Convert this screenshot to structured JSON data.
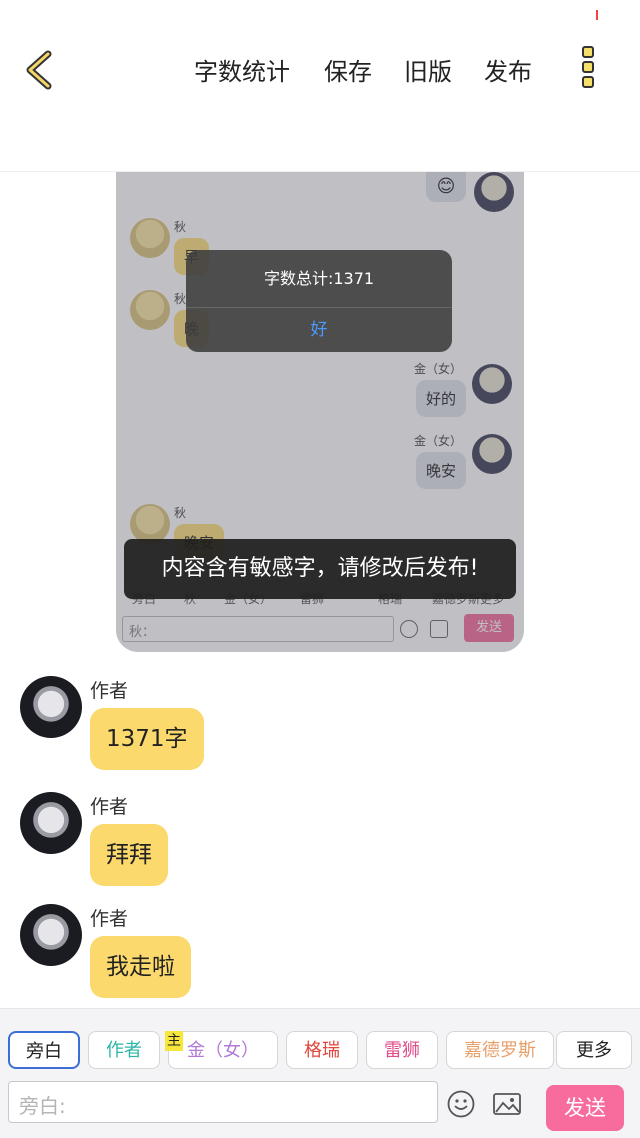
{
  "topbar": {
    "menu": [
      "字数统计",
      "保存",
      "旧版",
      "发布"
    ]
  },
  "embedded": {
    "messages": [
      {
        "name": "秋",
        "text": "早"
      },
      {
        "name": "秋",
        "text": "晚"
      },
      {
        "name": "金（女）",
        "text": "好的"
      },
      {
        "name": "金（女）",
        "text": "晚安"
      },
      {
        "name": "秋",
        "text": "晚安"
      }
    ],
    "emoji": "😊",
    "tabs": [
      "旁白",
      "秋",
      "金（女）",
      "雷狮",
      "格瑞",
      "嘉德罗斯",
      "更多"
    ],
    "input_placeholder": "秋：",
    "send": "发送",
    "alert": {
      "message": "字数总计:1371",
      "ok": "好"
    }
  },
  "toast": "内容含有敏感字，请修改后发布!",
  "chat": [
    {
      "author": "作者",
      "text": "1371字"
    },
    {
      "author": "作者",
      "text": "拜拜"
    },
    {
      "author": "作者",
      "text": "我走啦"
    }
  ],
  "bottom": {
    "roles": [
      {
        "label": "旁白",
        "color": "#222222"
      },
      {
        "label": "作者",
        "color": "#2db5a5"
      },
      {
        "label": "金（女）",
        "color": "#b07ad6"
      },
      {
        "label": "格瑞",
        "color": "#e0463c"
      },
      {
        "label": "雷狮",
        "color": "#e0508a"
      },
      {
        "label": "嘉德罗斯",
        "color": "#e8a06a"
      },
      {
        "label": "更多",
        "color": "#222222"
      }
    ],
    "main_badge": "主",
    "placeholder": "旁白:",
    "send": "发送"
  }
}
